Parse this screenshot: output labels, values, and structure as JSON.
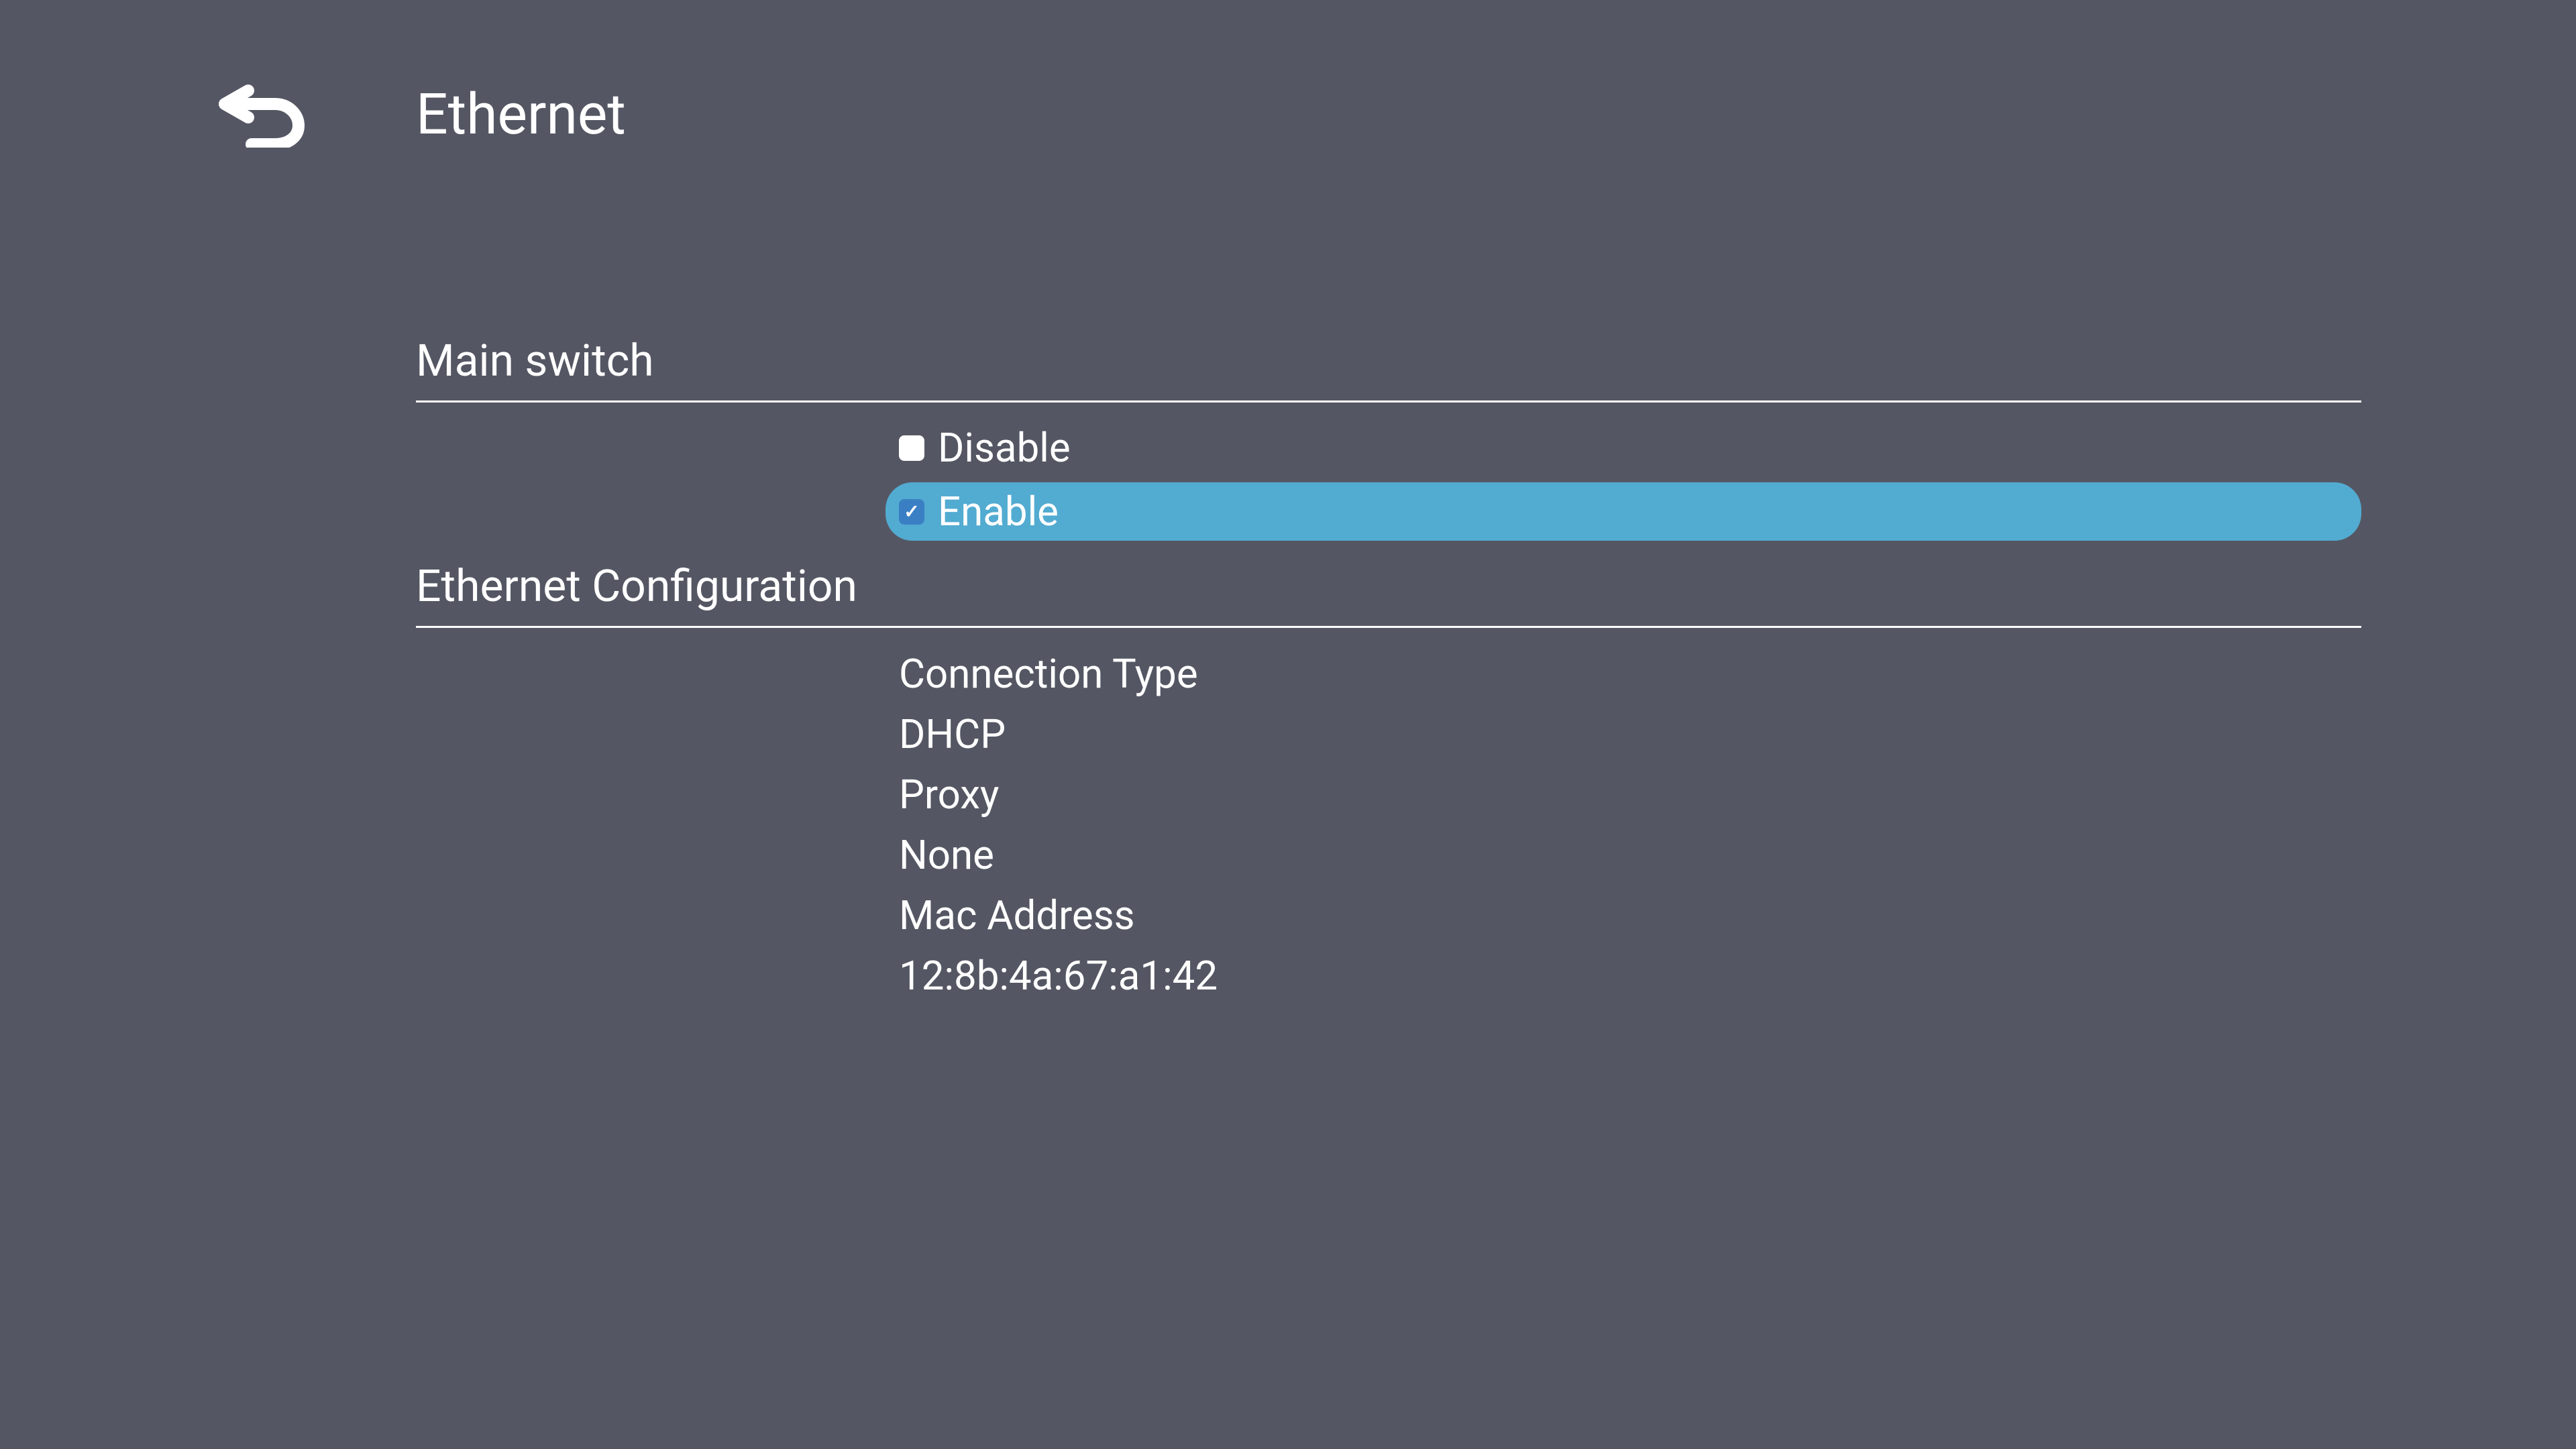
{
  "header": {
    "title": "Ethernet"
  },
  "sections": {
    "mainSwitch": {
      "title": "Main switch",
      "options": {
        "disable": "Disable",
        "enable": "Enable"
      }
    },
    "ethernetConfig": {
      "title": "Ethernet Configuration",
      "connectionType": {
        "label": "Connection Type",
        "value": "DHCP"
      },
      "proxy": {
        "label": "Proxy",
        "value": "None"
      },
      "macAddress": {
        "label": "Mac Address",
        "value": "12:8b:4a:67:a1:42"
      }
    }
  }
}
